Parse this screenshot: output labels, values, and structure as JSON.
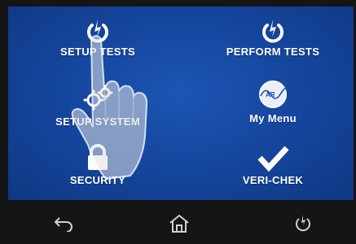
{
  "menu": {
    "setup_tests": {
      "label": "SETUP TESTS",
      "icon": "power-icon"
    },
    "perform_tests": {
      "label": "PERFORM TESTS",
      "icon": "power-icon"
    },
    "setup_system": {
      "label": "SETUP SYSTEM",
      "icon": "gears-icon"
    },
    "my_menu": {
      "label": "My Menu",
      "icon": "ar-wave-icon",
      "icon_text": "AR"
    },
    "security": {
      "label": "SECURITY",
      "icon": "lock-icon"
    },
    "veri_chek": {
      "label": "VERI-CHEK",
      "icon": "checkmark-icon"
    }
  },
  "navbar": {
    "back": {
      "icon": "back-arrow-icon"
    },
    "home": {
      "icon": "home-icon"
    },
    "power": {
      "icon": "power-icon"
    }
  },
  "colors": {
    "screen_blue": "#1547a0",
    "bezel": "#151515",
    "text": "#ffffff",
    "nav_icon": "#cfcfcf"
  }
}
